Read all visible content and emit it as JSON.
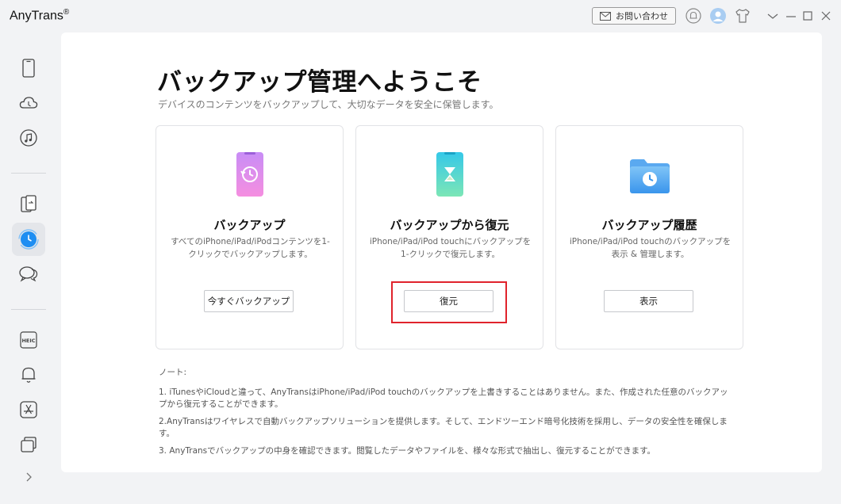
{
  "app": {
    "title": "AnyTrans",
    "title_mark": "®",
    "contact_label": "お問い合わせ"
  },
  "sidebar": {
    "items": [
      {
        "icon": "phone-icon"
      },
      {
        "icon": "cloud-icon"
      },
      {
        "icon": "music-icon"
      },
      {
        "icon": "phone-transfer-icon"
      },
      {
        "icon": "backup-clock-icon",
        "active": true
      },
      {
        "icon": "chat-bubbles-icon"
      },
      {
        "icon": "heic-convert-icon",
        "text": "HEIC"
      },
      {
        "icon": "bell-icon"
      },
      {
        "icon": "app-store-icon"
      },
      {
        "icon": "layers-icon"
      }
    ]
  },
  "main": {
    "title": "バックアップ管理へようこそ",
    "subtitle": "デバイスのコンテンツをバックアップして、大切なデータを安全に保管します。",
    "cards": [
      {
        "title": "バックアップ",
        "desc": "すべてのiPhone/iPad/iPodコンテンツを1-クリックでバックアップします。",
        "button": "今すぐバックアップ",
        "icon": "phone-restore-icon"
      },
      {
        "title": "バックアップから復元",
        "desc": "iPhone/iPad/iPod touchにバックアップを1-クリックで復元します。",
        "button": "復元",
        "icon": "phone-hourglass-icon"
      },
      {
        "title": "バックアップ履歴",
        "desc": "iPhone/iPad/iPod touchのバックアップを表示 & 管理します。",
        "button": "表示",
        "icon": "folder-clock-icon"
      }
    ],
    "notes": {
      "heading": "ノート:",
      "lines": [
        "1. iTunesやiCloudと違って、AnyTransはiPhone/iPad/iPod touchのバックアップを上書きすることはありません。また、作成された任意のバックアップから復元することができます。",
        "2.AnyTransはワイヤレスで自動バックアップソリューションを提供します。そして、エンドツーエンド暗号化技術を採用し、データの安全性を確保します。",
        "3. AnyTransでバックアップの中身を確認できます。閲覧したデータやファイルを、様々な形式で抽出し、復元することができます。"
      ]
    }
  },
  "colors": {
    "highlight": "#e0232c",
    "active_icon": "#1e8ef2"
  }
}
